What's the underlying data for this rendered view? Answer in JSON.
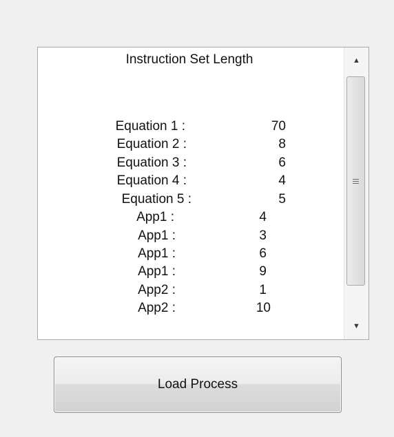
{
  "listbox": {
    "title": "Instruction Set Length",
    "rows": [
      {
        "label": "Equation 1 :",
        "value": "70"
      },
      {
        "label": "Equation 2 :",
        "value": "8"
      },
      {
        "label": "Equation 3 :",
        "value": "6"
      },
      {
        "label": "Equation 4 :",
        "value": "4"
      },
      {
        "label": "Equation 5 :",
        "value": "5"
      },
      {
        "label": "App1 :",
        "value": "4"
      },
      {
        "label": "App1 :",
        "value": "3"
      },
      {
        "label": "App1 :",
        "value": "6"
      },
      {
        "label": "App1 :",
        "value": "9"
      },
      {
        "label": "App2 :",
        "value": "1"
      },
      {
        "label": "App2 :",
        "value": "10"
      }
    ]
  },
  "scrollbar": {
    "up_icon": "▲",
    "down_icon": "▼"
  },
  "button": {
    "load_label": "Load Process"
  }
}
